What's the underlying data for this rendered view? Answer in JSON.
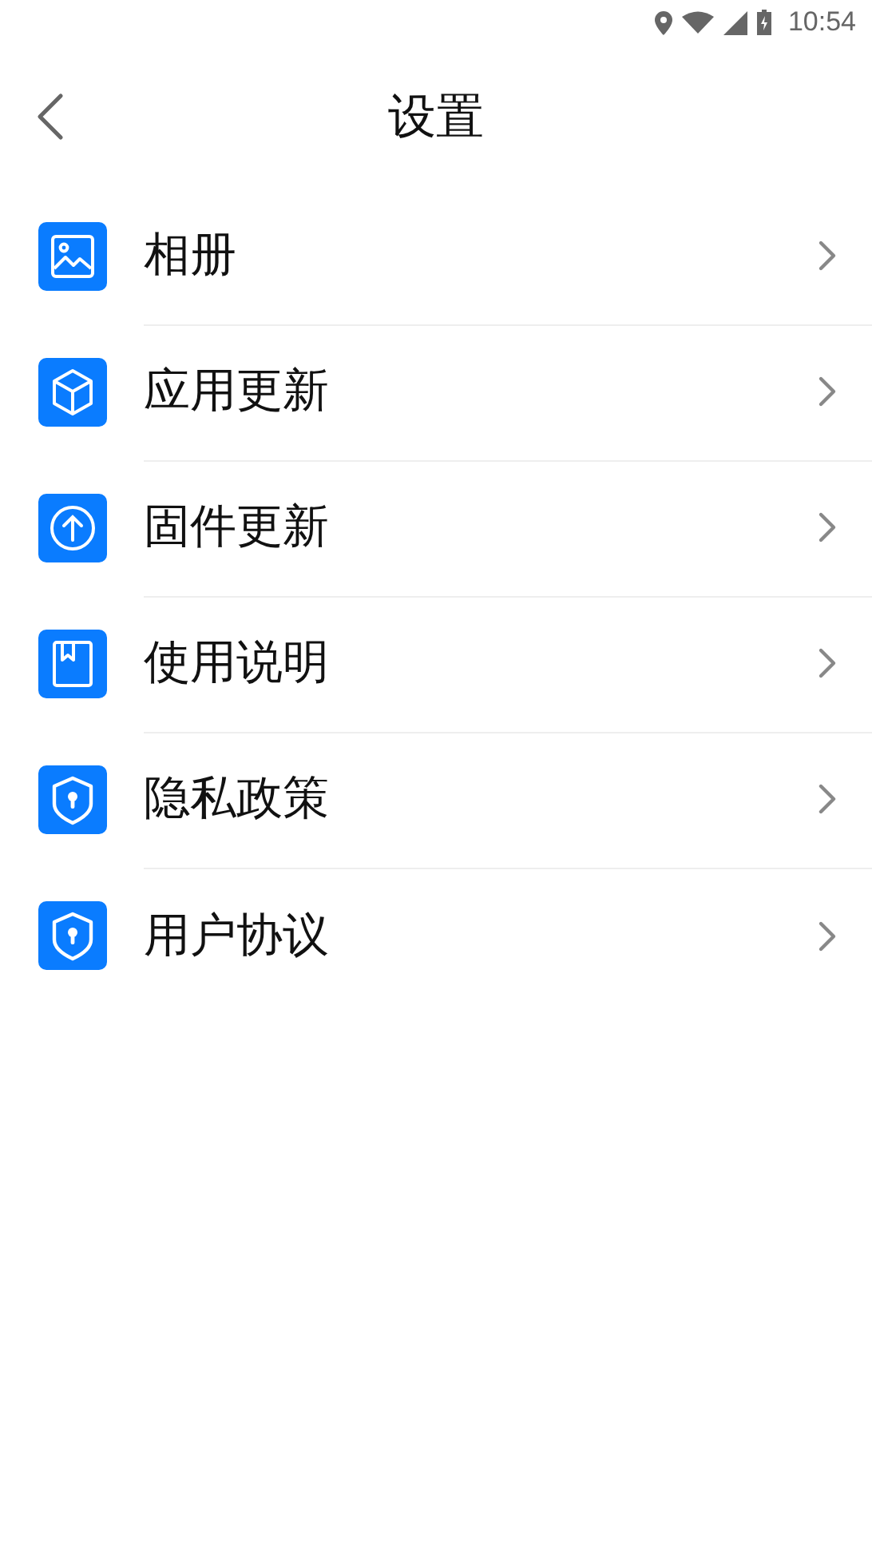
{
  "status_bar": {
    "time": "10:54"
  },
  "header": {
    "title": "设置"
  },
  "items": [
    {
      "label": "相册",
      "kind": "image"
    },
    {
      "label": "应用更新",
      "kind": "box"
    },
    {
      "label": "固件更新",
      "kind": "upload"
    },
    {
      "label": "使用说明",
      "kind": "book"
    },
    {
      "label": "隐私政策",
      "kind": "shield"
    },
    {
      "label": "用户协议",
      "kind": "shield"
    }
  ]
}
